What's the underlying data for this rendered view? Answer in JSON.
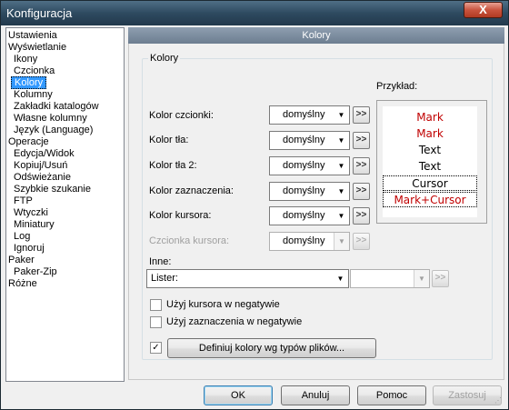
{
  "window": {
    "title": "Konfiguracja",
    "close_symbol": "X"
  },
  "tree": [
    {
      "label": "Ustawienia",
      "level": 0
    },
    {
      "label": "Wyświetlanie",
      "level": 0
    },
    {
      "label": "Ikony",
      "level": 1
    },
    {
      "label": "Czcionka",
      "level": 1
    },
    {
      "label": "Kolory",
      "level": 1,
      "selected": true
    },
    {
      "label": "Kolumny",
      "level": 1
    },
    {
      "label": "Zakładki katalogów",
      "level": 1
    },
    {
      "label": "Własne kolumny",
      "level": 1
    },
    {
      "label": "Język (Language)",
      "level": 1
    },
    {
      "label": "Operacje",
      "level": 0
    },
    {
      "label": "Edycja/Widok",
      "level": 1
    },
    {
      "label": "Kopiuj/Usuń",
      "level": 1
    },
    {
      "label": "Odświeżanie",
      "level": 1
    },
    {
      "label": "Szybkie szukanie",
      "level": 1
    },
    {
      "label": "FTP",
      "level": 1
    },
    {
      "label": "Wtyczki",
      "level": 1
    },
    {
      "label": "Miniatury",
      "level": 1
    },
    {
      "label": "Log",
      "level": 1
    },
    {
      "label": "Ignoruj",
      "level": 1
    },
    {
      "label": "Paker",
      "level": 0
    },
    {
      "label": "Paker-Zip",
      "level": 1
    },
    {
      "label": "Różne",
      "level": 0
    }
  ],
  "panel": {
    "header": "Kolory",
    "group_title": "Kolory",
    "rows": [
      {
        "label": "Kolor czcionki:",
        "value": "domyślny",
        "button": ">>"
      },
      {
        "label": "Kolor tła:",
        "value": "domyślny",
        "button": ">>"
      },
      {
        "label": "Kolor tła 2:",
        "value": "domyślny",
        "button": ">>"
      },
      {
        "label": "Kolor zaznaczenia:",
        "value": "domyślny",
        "button": ">>"
      },
      {
        "label": "Kolor kursora:",
        "value": "domyślny",
        "button": ">>"
      },
      {
        "label": "Czcionka kursora:",
        "value": "domyślny",
        "button": ">>"
      }
    ],
    "example_label": "Przykład:",
    "preview": [
      "Mark",
      "Mark",
      "Text",
      "Text",
      "Cursor",
      "Mark+Cursor"
    ],
    "inne_label": "Inne:",
    "inne_value": "Lister:",
    "inne_value2": "",
    "inne_button": ">>",
    "checkbox1": "Użyj kursora w negatywie",
    "checkbox2": "Użyj zaznaczenia w negatywie",
    "checkbox3_checked": "✓",
    "define_button": "Definiuj kolory wg typów plików..."
  },
  "footer": {
    "ok": "OK",
    "cancel": "Anuluj",
    "help": "Pomoc",
    "apply": "Zastosuj"
  },
  "colors": {
    "red": "#c00000",
    "selection": "#3399ff"
  }
}
